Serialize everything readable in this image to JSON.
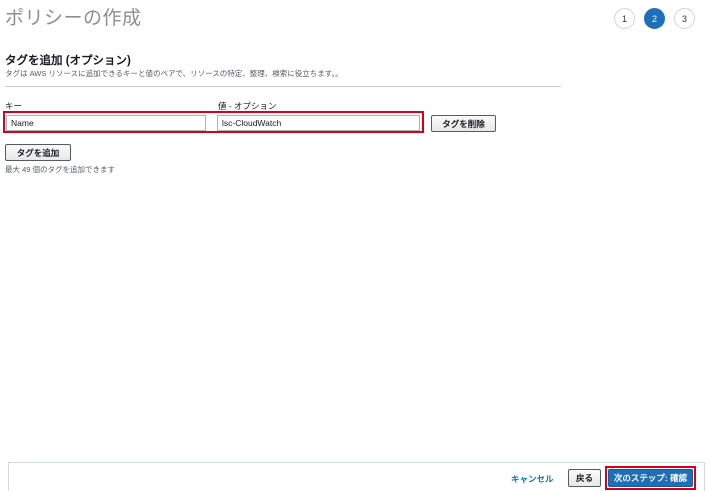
{
  "header": {
    "title": "ポリシーの作成",
    "steps": [
      "1",
      "2",
      "3"
    ],
    "active_step": "2"
  },
  "tags_section": {
    "heading": "タグを追加 (オプション)",
    "description": "タグは AWS リソースに追加できるキーと値のペアで、リソースの特定、整理、検索に役立ちます。。",
    "key_label": "キー",
    "value_label": "値 - オプション",
    "rows": [
      {
        "key": "Name",
        "value": "lsc-CloudWatch"
      }
    ],
    "remove_button": "タグを削除",
    "add_button": "タグを追加",
    "limit_note": "最大 49 個のタグを追加できます"
  },
  "footer": {
    "cancel_label": "キャンセル",
    "back_label": "戻る",
    "next_label": "次のステップ: 確認"
  },
  "colors": {
    "primary": "#1f6fb8",
    "highlight": "#d6001c",
    "link": "#0073bb"
  }
}
